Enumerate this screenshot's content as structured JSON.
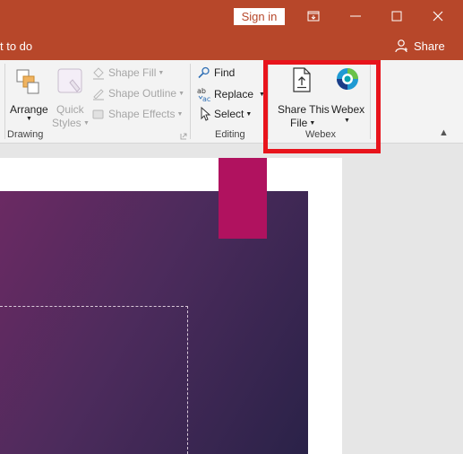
{
  "titlebar": {
    "signin_label": "Sign in"
  },
  "tellbar": {
    "tellme_text": "t to do",
    "share_label": "Share"
  },
  "ribbon": {
    "drawing": {
      "arrange": "Arrange",
      "quick": "Quick",
      "styles": "Styles",
      "shape_fill": "Shape Fill",
      "shape_outline": "Shape Outline",
      "shape_effects": "Shape Effects",
      "group_label": "Drawing"
    },
    "editing": {
      "find": "Find",
      "replace": "Replace",
      "select": "Select",
      "group_label": "Editing"
    },
    "webex": {
      "share_line1": "Share This",
      "share_line2": "File",
      "webex": "Webex",
      "group_label": "Webex"
    }
  },
  "colors": {
    "accent": "#b7472a",
    "highlight": "#e8141c",
    "slide_tab": "#b0125f"
  }
}
